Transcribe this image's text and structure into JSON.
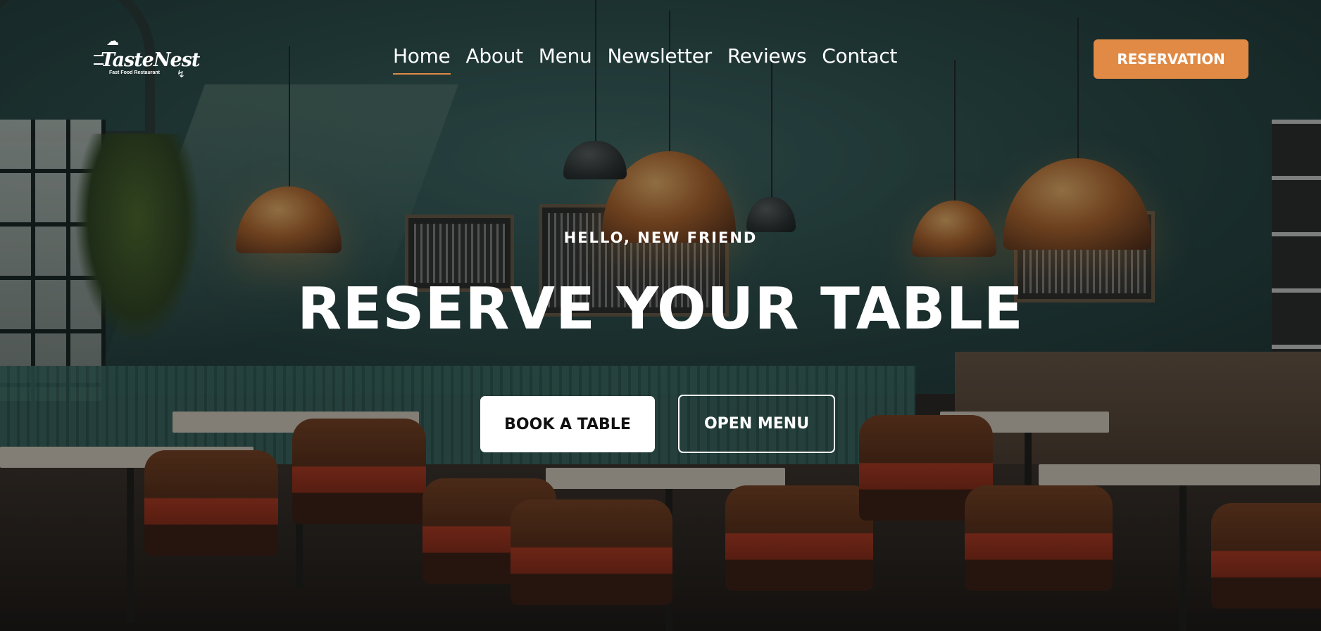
{
  "brand": {
    "name": "TasteNest",
    "tagline": "Fast Food Restaurant",
    "hat_icon": "chef-hat-icon"
  },
  "nav": {
    "items": [
      {
        "label": "Home",
        "active": true
      },
      {
        "label": "About",
        "active": false
      },
      {
        "label": "Menu",
        "active": false
      },
      {
        "label": "Newsletter",
        "active": false
      },
      {
        "label": "Reviews",
        "active": false
      },
      {
        "label": "Contact",
        "active": false
      }
    ],
    "cta_label": "RESERVATION"
  },
  "hero": {
    "kicker": "HELLO, NEW FRIEND",
    "title": "RESERVE YOUR TABLE",
    "primary_button": "BOOK A TABLE",
    "secondary_button": "OPEN MENU"
  },
  "colors": {
    "accent": "#e08a45",
    "text": "#ffffff",
    "primary_button_bg": "#ffffff",
    "primary_button_text": "#111111"
  }
}
